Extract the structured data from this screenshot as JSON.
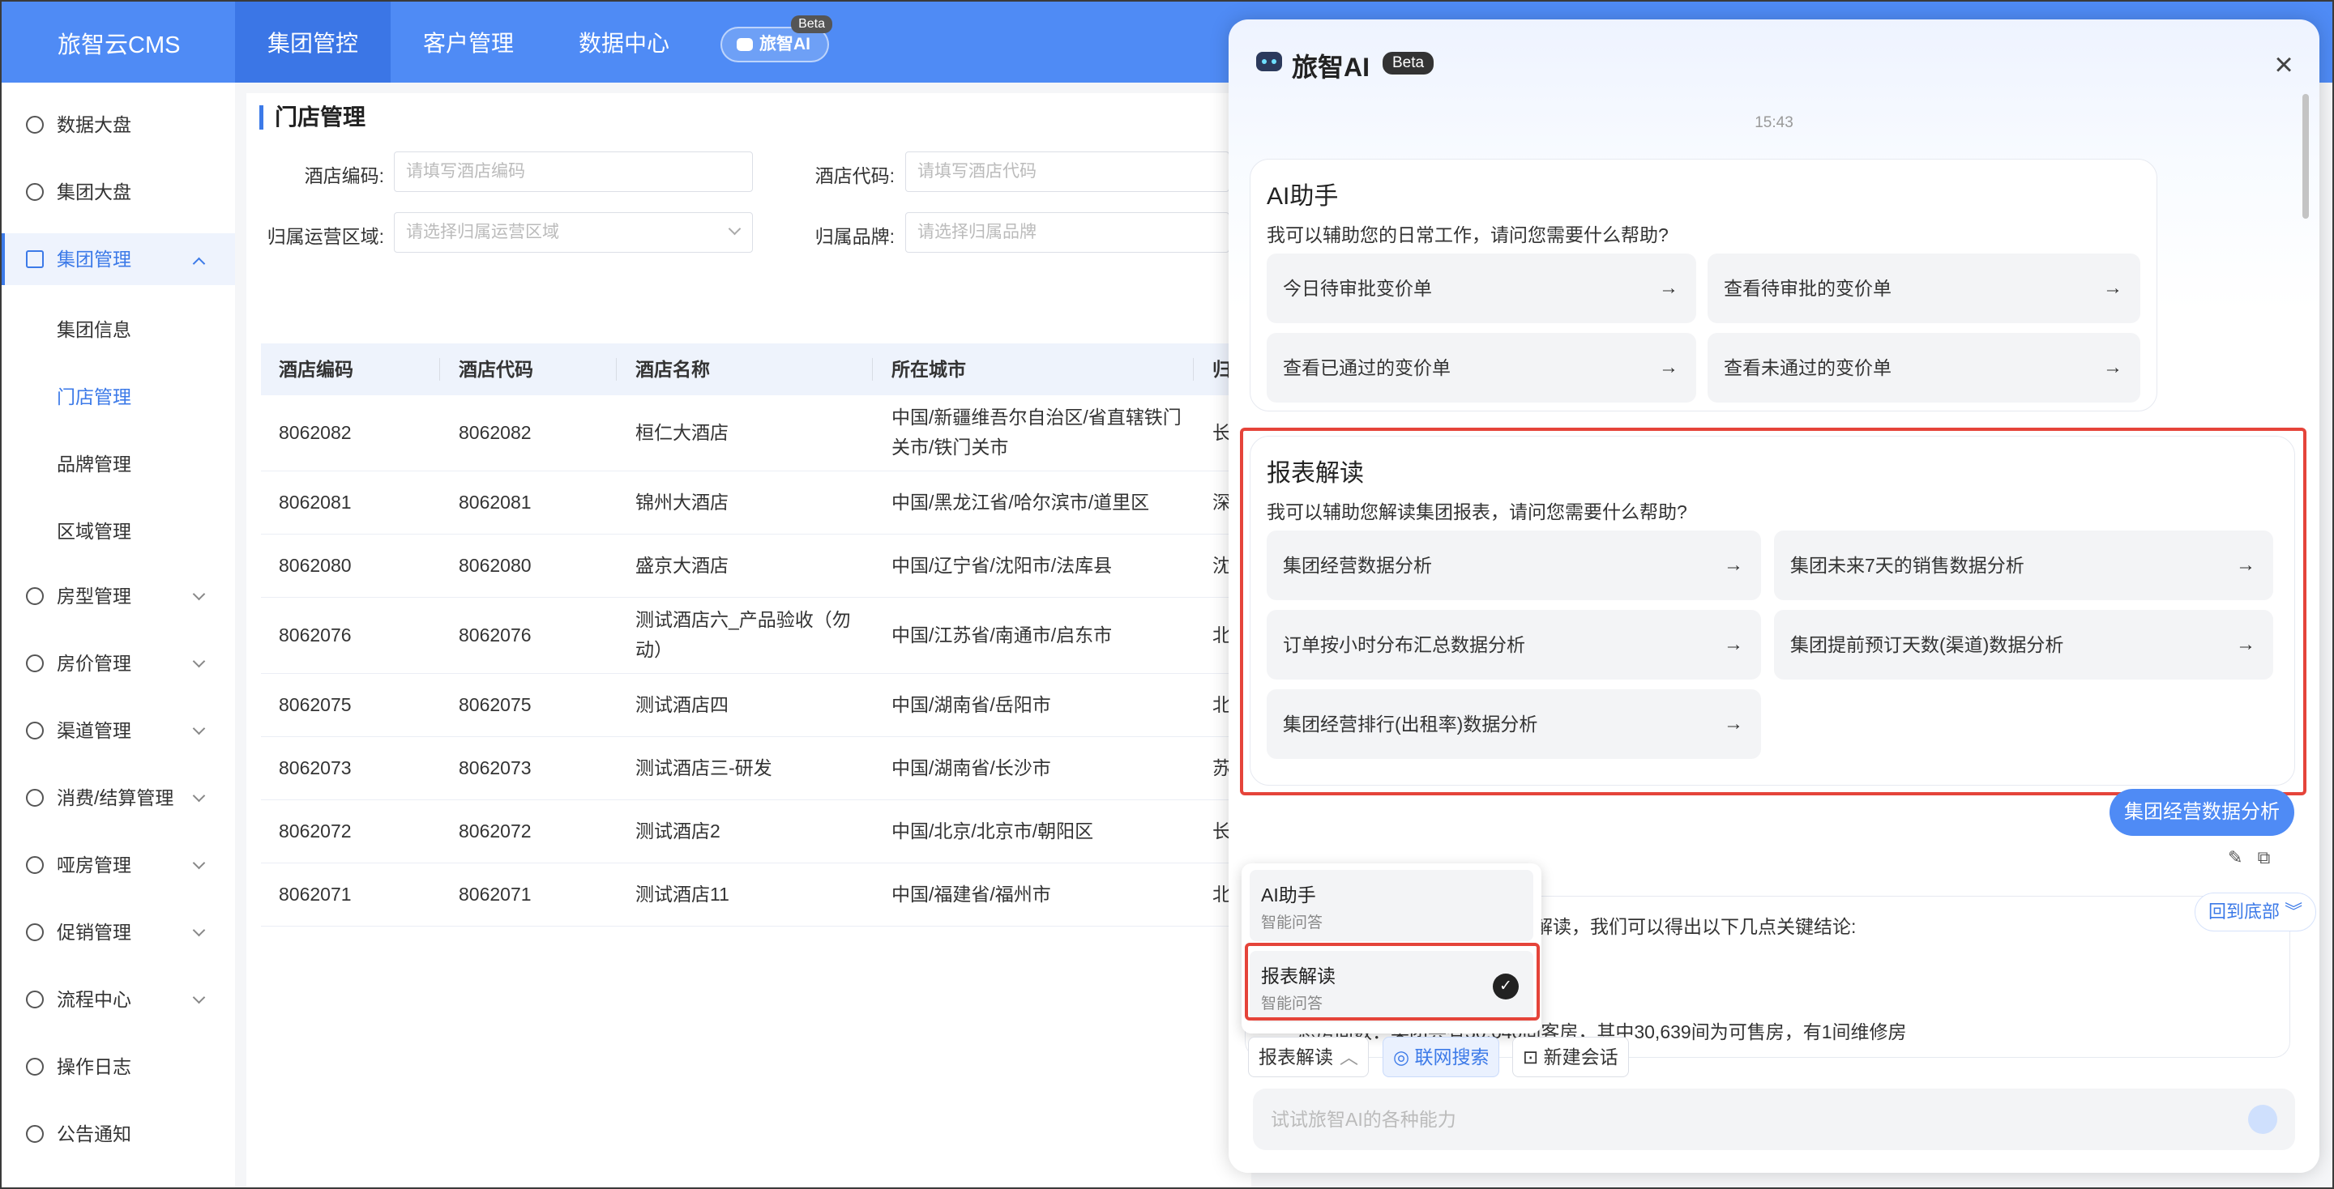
{
  "app": {
    "logo": "旅智云CMS"
  },
  "topnav": {
    "tabs": [
      {
        "label": "集团管控",
        "active": true
      },
      {
        "label": "客户管理",
        "active": false
      },
      {
        "label": "数据中心",
        "active": false
      }
    ],
    "ai_pill": {
      "label": "旅智AI",
      "badge": "Beta"
    }
  },
  "sidebar": {
    "items": [
      {
        "label": "数据大盘",
        "icon": "pie-chart-icon"
      },
      {
        "label": "集团大盘",
        "icon": "pie-chart-icon"
      },
      {
        "label": "集团管理",
        "icon": "monitor-icon",
        "expanded": true
      },
      {
        "label": "房型管理",
        "icon": "building-icon"
      },
      {
        "label": "房价管理",
        "icon": "card-icon"
      },
      {
        "label": "渠道管理",
        "icon": "network-icon"
      },
      {
        "label": "消费/结算管理",
        "icon": "yen-icon"
      },
      {
        "label": "哑房管理",
        "icon": "document-icon"
      },
      {
        "label": "促销管理",
        "icon": "badge-icon"
      },
      {
        "label": "流程中心",
        "icon": "clipboard-icon"
      },
      {
        "label": "操作日志",
        "icon": "log-icon"
      },
      {
        "label": "公告通知",
        "icon": "bell-icon"
      }
    ],
    "sub_items": [
      {
        "label": "集团信息",
        "active": false
      },
      {
        "label": "门店管理",
        "active": true
      },
      {
        "label": "品牌管理",
        "active": false
      },
      {
        "label": "区域管理",
        "active": false
      }
    ]
  },
  "page": {
    "title": "门店管理",
    "filters": [
      {
        "label": "酒店编码:",
        "placeholder": "请填写酒店编码"
      },
      {
        "label": "酒店代码:",
        "placeholder": "请填写酒店代码"
      },
      {
        "label": "归属运营区域:",
        "placeholder": "请选择归属运营区域"
      },
      {
        "label": "归属品牌:",
        "placeholder": "请选择归属品牌"
      }
    ]
  },
  "table": {
    "columns": [
      "酒店编码",
      "酒店代码",
      "酒店名称",
      "所在城市",
      "归"
    ],
    "rows": [
      {
        "code": "8062082",
        "hcode": "8062082",
        "name": "桓仁大酒店",
        "city": "中国/新疆维吾尔自治区/省直辖铁门关市/铁门关市",
        "region": "长"
      },
      {
        "code": "8062081",
        "hcode": "8062081",
        "name": "锦州大酒店",
        "city": "中国/黑龙江省/哈尔滨市/道里区",
        "region": "深"
      },
      {
        "code": "8062080",
        "hcode": "8062080",
        "name": "盛京大酒店",
        "city": "中国/辽宁省/沈阳市/法库县",
        "region": "沈"
      },
      {
        "code": "8062076",
        "hcode": "8062076",
        "name": "测试酒店六_产品验收（勿动）",
        "city": "中国/江苏省/南通市/启东市",
        "region": "北"
      },
      {
        "code": "8062075",
        "hcode": "8062075",
        "name": "测试酒店四",
        "city": "中国/湖南省/岳阳市",
        "region": "北"
      },
      {
        "code": "8062073",
        "hcode": "8062073",
        "name": "测试酒店三-研发",
        "city": "中国/湖南省/长沙市",
        "region": "苏"
      },
      {
        "code": "8062072",
        "hcode": "8062072",
        "name": "测试酒店2",
        "city": "中国/北京/北京市/朝阳区",
        "region": "长"
      },
      {
        "code": "8062071",
        "hcode": "8062071",
        "name": "测试酒店11",
        "city": "中国/福建省/福州市",
        "region": "北"
      }
    ]
  },
  "ai": {
    "title": "旅智AI",
    "badge": "Beta",
    "close": "×",
    "time": "15:43",
    "assistant": {
      "title": "AI助手",
      "subtitle": "我可以辅助您的日常工作，请问您需要什么帮助?",
      "buttons": [
        "今日待审批变价单",
        "查看待审批的变价单",
        "查看已通过的变价单",
        "查看未通过的变价单"
      ]
    },
    "report": {
      "title": "报表解读",
      "subtitle": "我可以辅助您解读集团报表，请问您需要什么帮助?",
      "buttons": [
        "集团经营数据分析",
        "集团未来7天的销售数据分析",
        "订单按小时分布汇总数据分析",
        "集团提前预订天数(渠道)数据分析",
        "集团经营排行(出租率)数据分析"
      ]
    },
    "arrow": "→",
    "user_message": "集团经营数据分析",
    "answer_text": "进行解读，我们可以得出以下几点关键结论:",
    "answer_cut": "总房间数：集团共有30,640间客房，其中30,639间为可售房，有1间维修房",
    "back_to_bottom": "回到底部",
    "mode_menu": [
      {
        "title": "AI助手",
        "sub": "智能问答"
      },
      {
        "title": "报表解读",
        "sub": "智能问答",
        "selected": true
      }
    ],
    "toolbar": {
      "mode": "报表解读",
      "web_search": "联网搜索",
      "new_chat": "新建会话"
    },
    "input_placeholder": "试试旅智AI的各种能力",
    "accent": "#4f8bf5",
    "highlight": "#e5443a"
  }
}
